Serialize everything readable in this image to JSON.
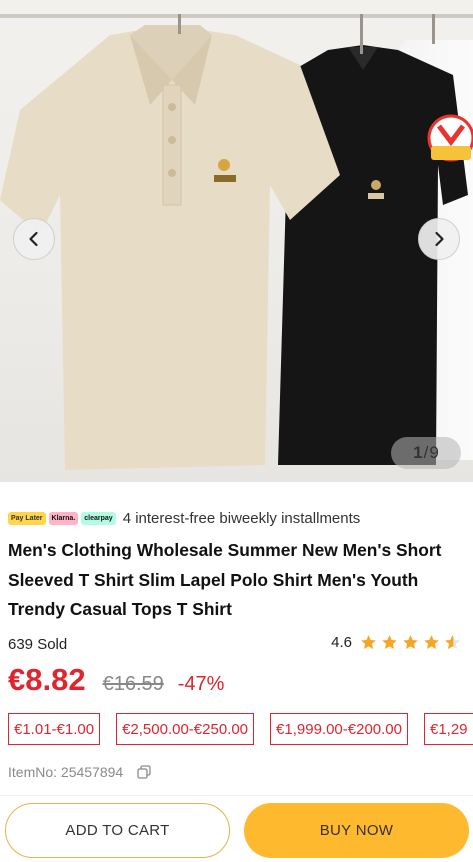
{
  "gallery": {
    "current": "1",
    "total": "9",
    "separator": "/"
  },
  "installments": {
    "logos": [
      "Pay Later",
      "Klarna.",
      "clearpay"
    ],
    "text": "4 interest-free biweekly installments"
  },
  "product": {
    "title": "Men's Clothing Wholesale Summer New Men's Short Sleeved T Shirt Slim Lapel Polo Shirt Men's Youth Trendy Casual Tops T Shirt",
    "sold": "639 Sold",
    "rating": "4.6",
    "rating_value": 4.6,
    "price": "€8.82",
    "original_price": "€16.59",
    "discount": "-47%",
    "tiers": [
      "€1.01-€1.00",
      "€2,500.00-€250.00",
      "€1,999.00-€200.00",
      "€1,29"
    ],
    "item_no": "ItemNo: 25457894"
  },
  "actions": {
    "add_to_cart": "ADD TO CART",
    "buy_now": "BUY NOW"
  },
  "colors": {
    "accent_red": "#e0252e",
    "buy_button": "#ffb92e",
    "cart_border": "#e6b34a",
    "star": "#f5a623"
  },
  "icons": {
    "prev": "chevron-left-icon",
    "next": "chevron-right-icon",
    "star": "star-icon",
    "copy": "copy-icon"
  }
}
